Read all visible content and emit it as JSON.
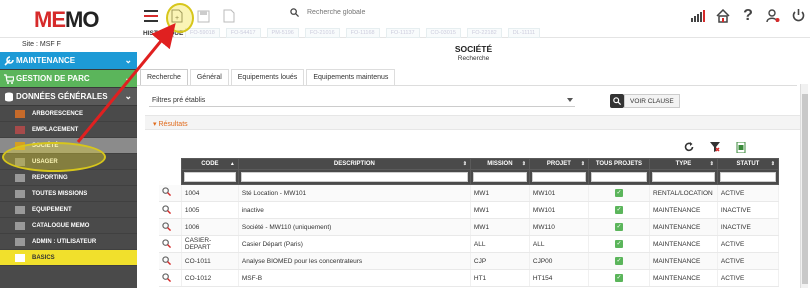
{
  "logo": {
    "text_left": "ME",
    "text_right": "MO"
  },
  "site_label": "Site : MSF F",
  "search": {
    "placeholder": "Recherche globale"
  },
  "historique_label": "HISTORIQUE",
  "history_tabs": [
    "FO-59018",
    "FO-54417",
    "PM-5196",
    "FO-21016",
    "FO-11168",
    "FO-11137",
    "CO-03015",
    "FO-22182",
    "DL-11111"
  ],
  "sidebar": {
    "main": [
      {
        "label": "MAINTENANCE",
        "color": "#1d9ad6"
      },
      {
        "label": "GESTION DE PARC",
        "color": "#5bb55b"
      },
      {
        "label": "DONNÉES GÉNÉRALES",
        "color": "#5a5a5a"
      }
    ],
    "items": [
      {
        "label": "ARBORESCENCE"
      },
      {
        "label": "EMPLACEMENT"
      },
      {
        "label": "SOCIÉTÉ"
      },
      {
        "label": "USAGER"
      },
      {
        "label": "REPORTING"
      },
      {
        "label": "TOUTES MISSIONS"
      },
      {
        "label": "EQUIPEMENT"
      },
      {
        "label": "CATALOGUE MEMO"
      },
      {
        "label": "ADMIN : UTILISATEUR"
      },
      {
        "label": "BASICS"
      }
    ]
  },
  "page": {
    "title": "SOCIÉTÉ",
    "subtitle": "Recherche"
  },
  "tabs": [
    "Recherche",
    "Général",
    "Equipements loués",
    "Equipements maintenus"
  ],
  "filters": {
    "select_value": "Filtres pré établis",
    "voir_clause_label": "VOIR CLAUSE"
  },
  "results_label": "Résultats",
  "table": {
    "columns": [
      "CODE",
      "DESCRIPTION",
      "MISSION",
      "PROJET",
      "TOUS PROJETS",
      "TYPE",
      "STATUT"
    ],
    "rows": [
      [
        "1004",
        "Sté Location - MW101",
        "MW1",
        "MW101",
        "",
        "RENTAL/LOCATION",
        "ACTIVE"
      ],
      [
        "1005",
        "inactive",
        "MW1",
        "MW101",
        "",
        "MAINTENANCE",
        "INACTIVE"
      ],
      [
        "1006",
        "Société - MW110 (uniquement)",
        "MW1",
        "MW110",
        "",
        "MAINTENANCE",
        "INACTIVE"
      ],
      [
        "CASIER-\nDEPART",
        "Casier Départ (Paris)",
        "ALL",
        "ALL",
        "",
        "MAINTENANCE",
        "ACTIVE"
      ],
      [
        "CO-1011",
        "Analyse BIOMED pour les concentrateurs",
        "CJP",
        "CJP00",
        "",
        "MAINTENANCE",
        "ACTIVE"
      ],
      [
        "CO-1012",
        "MSF-B",
        "HT1",
        "HT154",
        "",
        "MAINTENANCE",
        "ACTIVE"
      ]
    ]
  },
  "colors": {
    "accent_blue": "#1d9ad6",
    "accent_green": "#5bb55b",
    "highlight_yellow": "#f1e02c",
    "annotation_red": "#e02020",
    "result_orange": "#e06a1b"
  }
}
